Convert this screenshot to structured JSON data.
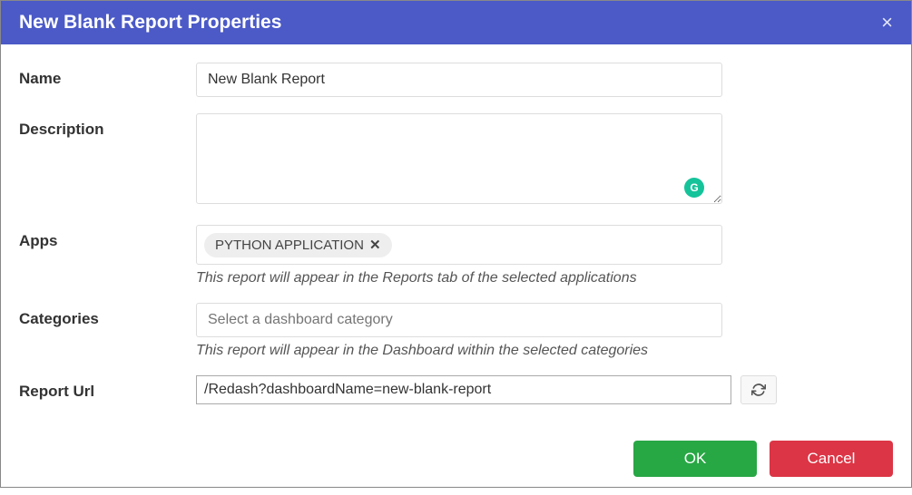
{
  "modal": {
    "title": "New Blank Report Properties"
  },
  "form": {
    "name": {
      "label": "Name",
      "value": "New Blank Report"
    },
    "description": {
      "label": "Description",
      "value": ""
    },
    "apps": {
      "label": "Apps",
      "tags": [
        "PYTHON APPLICATION"
      ],
      "help": "This report will appear in the Reports tab of the selected applications"
    },
    "categories": {
      "label": "Categories",
      "placeholder": "Select a dashboard category",
      "help": "This report will appear in the Dashboard within the selected categories"
    },
    "report_url": {
      "label": "Report Url",
      "value": "/Redash?dashboardName=new-blank-report"
    }
  },
  "buttons": {
    "ok": "OK",
    "cancel": "Cancel"
  },
  "icons": {
    "close": "×",
    "tag_remove": "✕",
    "grammarly": "G"
  }
}
